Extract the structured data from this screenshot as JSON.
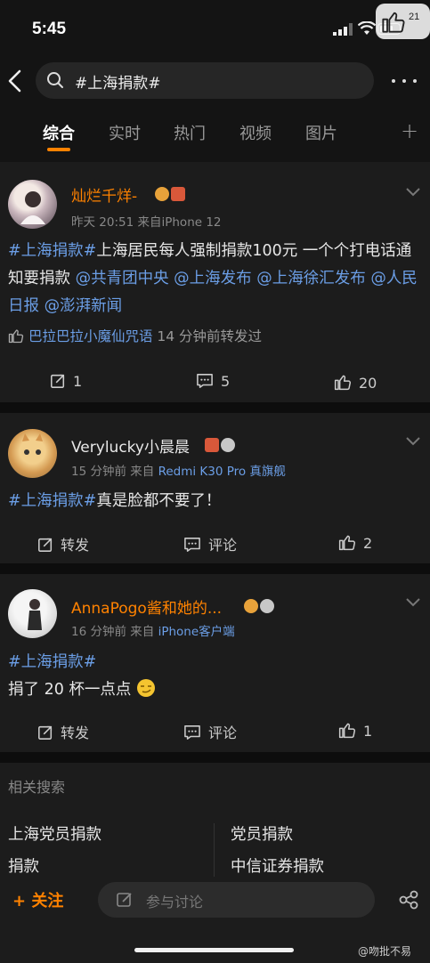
{
  "status_bar": {
    "time": "5:45",
    "corner_like_count": "21"
  },
  "search": {
    "query": "#上海捐款#"
  },
  "tabs": [
    {
      "label": "综合",
      "active": true
    },
    {
      "label": "实时",
      "active": false
    },
    {
      "label": "热门",
      "active": false
    },
    {
      "label": "视频",
      "active": false
    },
    {
      "label": "图片",
      "active": false
    }
  ],
  "posts": [
    {
      "username": "灿烂千烊-",
      "meta": "昨天 20:51  来自iPhone 12",
      "text_parts": [
        "#上海捐款#",
        "上海居民每人强制捐款100元 一个个打电话通知要捐款",
        "@共青团中央",
        "@上海发布",
        "@上海徐汇发布",
        "@人民日报",
        "@澎湃新闻"
      ],
      "repost_user": "巴拉巴拉小魔仙咒语",
      "repost_note": "14 分钟前转发过",
      "repost_count": "1",
      "comment_count": "5",
      "like_count": "20"
    },
    {
      "username": "Verylucky小晨晨",
      "meta": "15 分钟前  来自",
      "device": "Redmi K30 Pro 真旗舰",
      "text_parts": [
        "#上海捐款#",
        "真是脸都不要了！"
      ],
      "repost_label": "转发",
      "comment_label": "评论",
      "like_count": "2"
    },
    {
      "username": "AnnaPogo酱和她的...",
      "meta": "16 分钟前  来自",
      "device": "iPhone客户端",
      "text_parts": [
        "#上海捐款#",
        "捐了 20 杯一点点"
      ],
      "repost_label": "转发",
      "comment_label": "评论",
      "like_count": "1"
    }
  ],
  "related": {
    "title": "相关搜索",
    "items": [
      "上海党员捐款",
      "党员捐款",
      "捐款",
      "中信证券捐款"
    ]
  },
  "bottom_bar": {
    "follow_label": "关注",
    "comment_placeholder": "参与讨论"
  },
  "watermark": "@吻批不易",
  "colors": {
    "accent": "#ff8200",
    "link": "#6b9ee6",
    "background": "#141414",
    "card": "#1c1c1c"
  }
}
